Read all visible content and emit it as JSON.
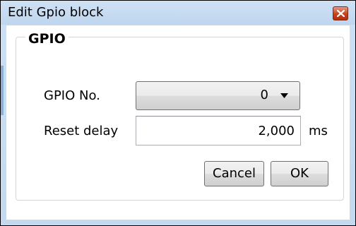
{
  "window": {
    "title": "Edit Gpio block"
  },
  "group": {
    "legend": "GPIO"
  },
  "form": {
    "gpio_label": "GPIO No.",
    "gpio_value": "0",
    "reset_label": "Reset delay",
    "reset_value": "2,000",
    "reset_unit": "ms"
  },
  "buttons": {
    "cancel": "Cancel",
    "ok": "OK"
  },
  "icons": {
    "close": "close-icon",
    "dropdown": "chevron-down-icon"
  },
  "colors": {
    "titlebar": "#c9dcf1",
    "close_button": "#c8401c"
  }
}
